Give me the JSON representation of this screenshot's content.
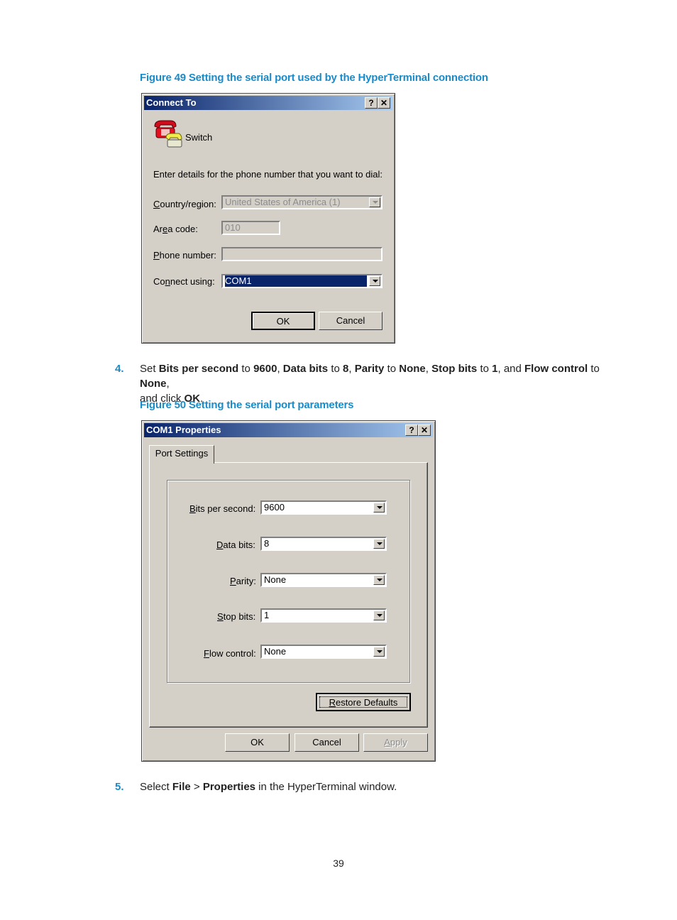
{
  "figure49": {
    "caption": "Figure 49 Setting the serial port used by the HyperTerminal connection",
    "dialog": {
      "title": "Connect To",
      "help_button": "?",
      "close_button": "✕",
      "connection_name": "Switch",
      "instruction": "Enter details for the phone number that you want to dial:",
      "fields": {
        "country_label_pre": "",
        "country_label_u": "C",
        "country_label_post": "ountry/region:",
        "country_value": "United States of America (1)",
        "area_label_pre": "Ar",
        "area_label_u": "e",
        "area_label_post": "a code:",
        "area_value": "010",
        "phone_label_pre": "",
        "phone_label_u": "P",
        "phone_label_post": "hone number:",
        "phone_value": "",
        "connect_label_pre": "Co",
        "connect_label_u": "n",
        "connect_label_post": "nect using:",
        "connect_value": "COM1"
      },
      "ok": "OK",
      "cancel": "Cancel"
    }
  },
  "step4": {
    "number": "4.",
    "parts": [
      "Set ",
      "Bits per second",
      " to ",
      "9600",
      ", ",
      "Data bits",
      " to ",
      "8",
      ", ",
      "Parity",
      " to ",
      "None",
      ", ",
      "Stop bits",
      " to ",
      "1",
      ", and ",
      "Flow control",
      " to ",
      "None",
      ",",
      "and click ",
      "OK",
      "."
    ]
  },
  "figure50": {
    "caption": "Figure 50 Setting the serial port parameters",
    "dialog": {
      "title": "COM1 Properties",
      "help_button": "?",
      "close_button": "✕",
      "tab": "Port Settings",
      "fields": {
        "bps_u": "B",
        "bps_rest": "its per second:",
        "bps_value": "9600",
        "data_u": "D",
        "data_rest": "ata bits:",
        "data_value": "8",
        "parity_u": "P",
        "parity_rest": "arity:",
        "parity_value": "None",
        "stop_u": "S",
        "stop_rest": "top bits:",
        "stop_value": "1",
        "flow_u": "F",
        "flow_rest": "low control:",
        "flow_value": "None"
      },
      "restore_u": "R",
      "restore_rest": "estore Defaults",
      "ok": "OK",
      "cancel": "Cancel",
      "apply_u": "A",
      "apply_rest": "pply"
    }
  },
  "step5": {
    "number": "5.",
    "parts": [
      "Select ",
      "File",
      " > ",
      "Properties",
      " in the HyperTerminal window."
    ]
  },
  "page_number": "39"
}
